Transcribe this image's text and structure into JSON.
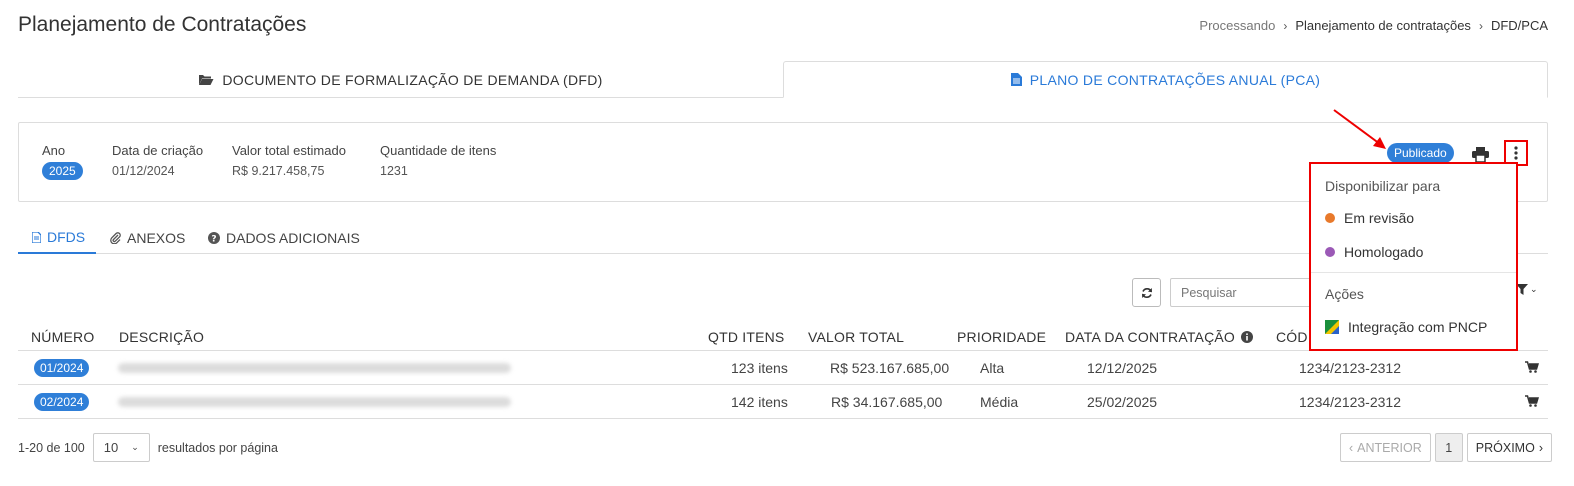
{
  "page": {
    "title": "Planejamento de Contratações",
    "breadcrumb": [
      "Processando",
      "Planejamento de contratações",
      "DFD/PCA"
    ]
  },
  "main_tabs": [
    {
      "label": "Documento de Formalização de Demanda (DFD)",
      "icon": "folder-open-icon",
      "active": false
    },
    {
      "label": "Plano de Contratações Anual (PCA)",
      "icon": "file-icon",
      "active": true
    }
  ],
  "summary": {
    "year_label": "Ano",
    "year_value": "2025",
    "created_label": "Data de criação",
    "created_value": "01/12/2024",
    "total_label": "Valor total estimado",
    "total_value": "R$ 9.217.458,75",
    "qty_label": "Quantidade de itens",
    "qty_value": "1231",
    "status": "Publicado"
  },
  "dropdown": {
    "header1": "Disponibilizar para",
    "items": [
      {
        "label": "Em revisão",
        "color": "#e8792b"
      },
      {
        "label": "Homologado",
        "color": "#9b59b6"
      }
    ],
    "header2": "Ações",
    "action": "Integração com PNCP"
  },
  "sub_tabs": [
    {
      "label": "DFDs",
      "icon": "file-icon",
      "active": true
    },
    {
      "label": "Anexos",
      "icon": "paperclip-icon",
      "active": false
    },
    {
      "label": "Dados Adicionais",
      "icon": "question-circle-icon",
      "active": false
    }
  ],
  "toolbar": {
    "search_placeholder": "Pesquisar"
  },
  "table": {
    "columns": [
      "NÚMERO",
      "DESCRIÇÃO",
      "QTD ITENS",
      "VALOR TOTAL",
      "PRIORIDADE",
      "DATA DA CONTRATAÇÃO",
      "CÓD"
    ],
    "rows": [
      {
        "numero": "01/2024",
        "qtd": "123 itens",
        "valor": "R$ 523.167.685,00",
        "prioridade": "Alta",
        "data": "12/12/2025",
        "codigo": "1234/2123-2312"
      },
      {
        "numero": "02/2024",
        "qtd": "142 itens",
        "valor": "R$ 34.167.685,00",
        "prioridade": "Média",
        "data": "25/02/2025",
        "codigo": "1234/2123-2312"
      }
    ]
  },
  "pagination": {
    "range": "1-20 de 100",
    "per_page": "10",
    "per_page_label": "resultados por página",
    "prev": "ANTERIOR",
    "current": "1",
    "next": "PRÓXIMO"
  },
  "colors": {
    "accent": "#2a7ad8",
    "badge": "#2f7fd8",
    "highlight": "#e00000"
  }
}
